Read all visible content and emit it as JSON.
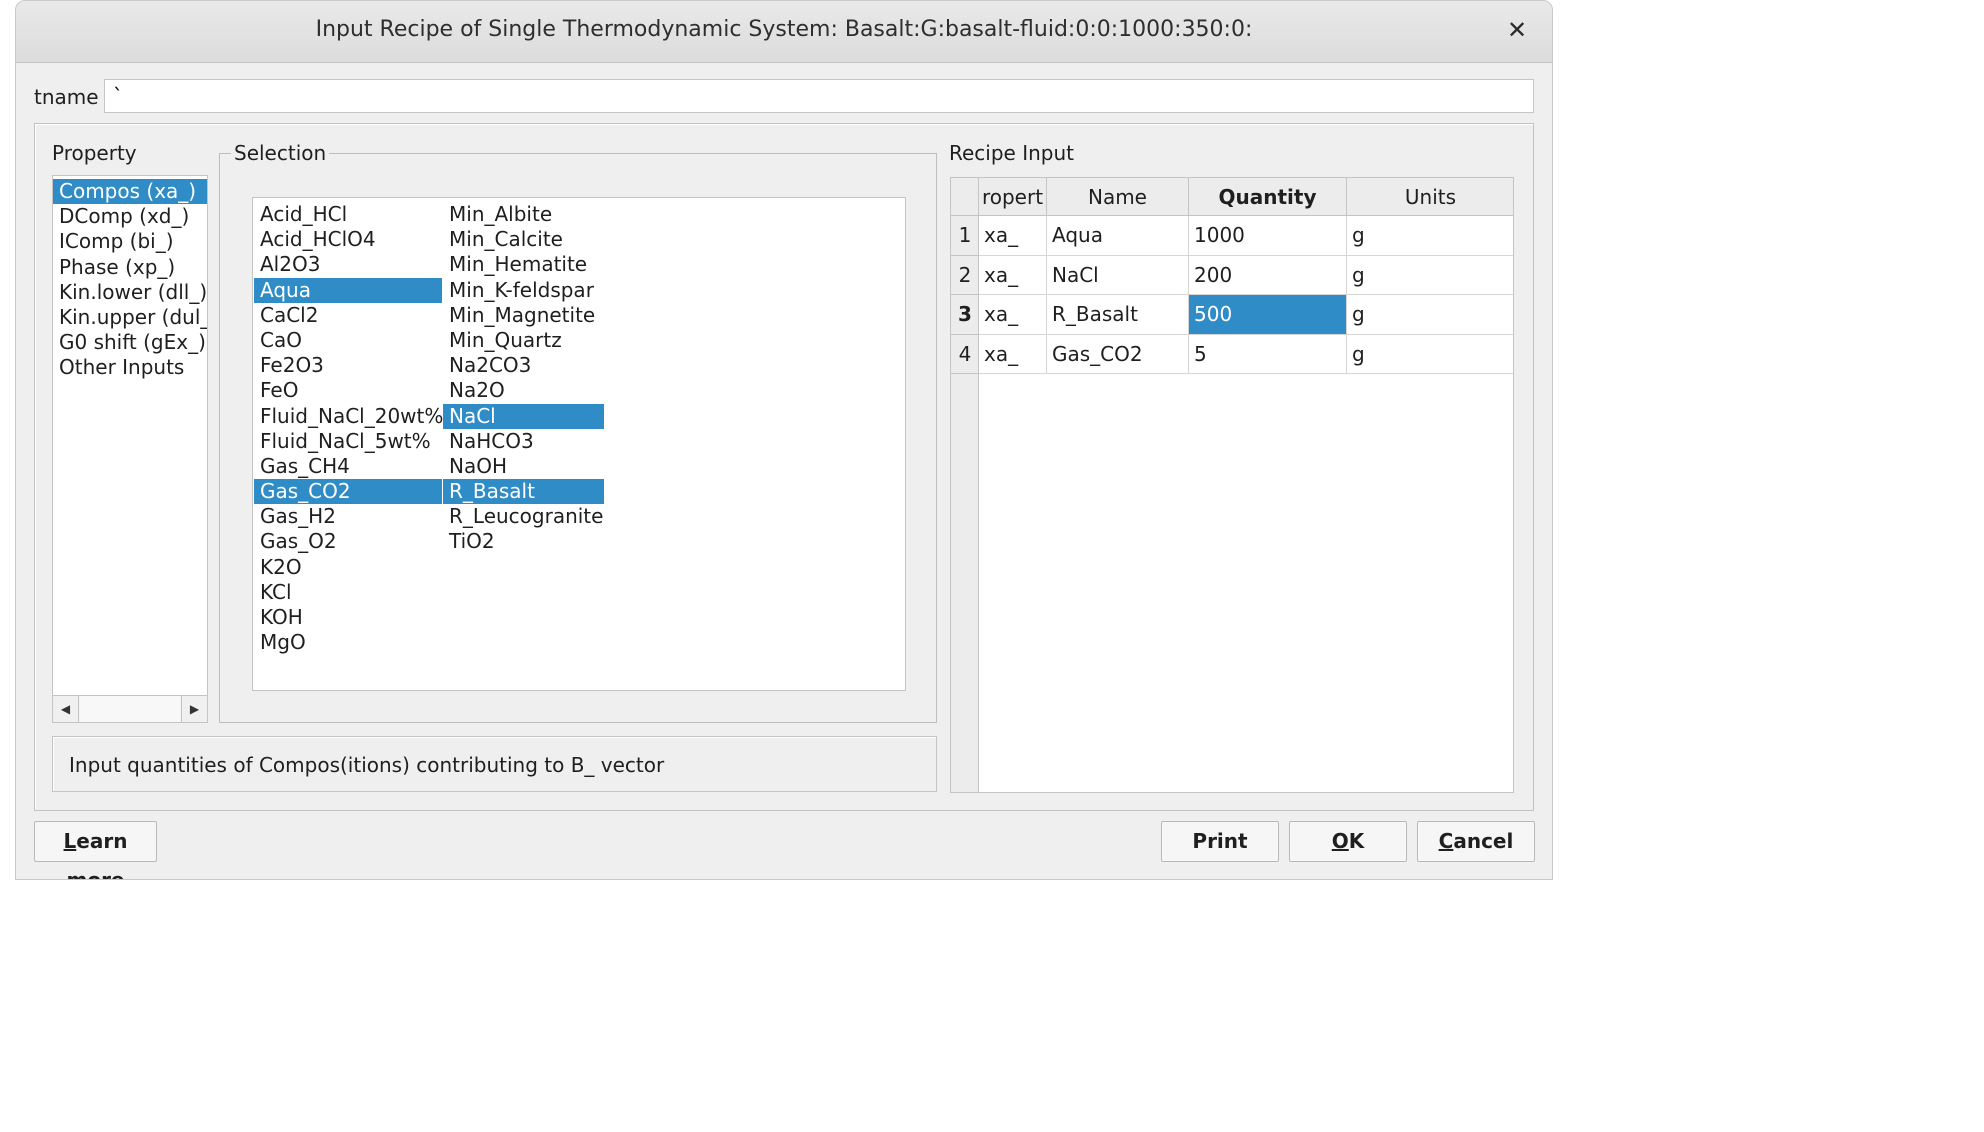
{
  "window": {
    "title": "Input Recipe of Single Thermodynamic System: Basalt:G:basalt-fluid:0:0:1000:350:0:",
    "close_symbol": "✕"
  },
  "tname": {
    "label": "tname",
    "value": "`"
  },
  "property": {
    "label": "Property",
    "items": [
      {
        "label": "Compos (xa_)",
        "selected": true
      },
      {
        "label": "DComp (xd_)",
        "selected": false
      },
      {
        "label": "IComp (bi_)",
        "selected": false
      },
      {
        "label": "Phase (xp_)",
        "selected": false
      },
      {
        "label": "Kin.lower (dll_)",
        "selected": false
      },
      {
        "label": "Kin.upper (dul_)",
        "selected": false
      },
      {
        "label": "G0 shift (gEx_)",
        "selected": false
      },
      {
        "label": "Other Inputs",
        "selected": false
      }
    ],
    "scroll_left_icon": "◀",
    "scroll_right_icon": "▶"
  },
  "selection": {
    "label": "Selection",
    "col1": [
      {
        "label": "Acid_HCl",
        "selected": false
      },
      {
        "label": "Acid_HClO4",
        "selected": false
      },
      {
        "label": "Al2O3",
        "selected": false
      },
      {
        "label": "Aqua",
        "selected": true
      },
      {
        "label": "CaCl2",
        "selected": false
      },
      {
        "label": "CaO",
        "selected": false
      },
      {
        "label": "Fe2O3",
        "selected": false
      },
      {
        "label": "FeO",
        "selected": false
      },
      {
        "label": "Fluid_NaCl_20wt%",
        "selected": false
      },
      {
        "label": "Fluid_NaCl_5wt%",
        "selected": false
      },
      {
        "label": "Gas_CH4",
        "selected": false
      },
      {
        "label": "Gas_CO2",
        "selected": true
      },
      {
        "label": "Gas_H2",
        "selected": false
      },
      {
        "label": "Gas_O2",
        "selected": false
      },
      {
        "label": "K2O",
        "selected": false
      },
      {
        "label": "KCl",
        "selected": false
      },
      {
        "label": "KOH",
        "selected": false
      },
      {
        "label": "MgO",
        "selected": false
      }
    ],
    "col2": [
      {
        "label": "Min_Albite",
        "selected": false
      },
      {
        "label": "Min_Calcite",
        "selected": false
      },
      {
        "label": "Min_Hematite",
        "selected": false
      },
      {
        "label": "Min_K-feldspar",
        "selected": false
      },
      {
        "label": "Min_Magnetite",
        "selected": false
      },
      {
        "label": "Min_Quartz",
        "selected": false
      },
      {
        "label": "Na2CO3",
        "selected": false
      },
      {
        "label": "Na2O",
        "selected": false
      },
      {
        "label": "NaCl",
        "selected": true
      },
      {
        "label": "NaHCO3",
        "selected": false
      },
      {
        "label": "NaOH",
        "selected": false
      },
      {
        "label": "R_Basalt",
        "selected": true
      },
      {
        "label": "R_Leucogranite",
        "selected": false
      },
      {
        "label": "TiO2",
        "selected": false
      }
    ]
  },
  "hint": "Input quantities of Compos(itions) contributing to B_ vector",
  "recipe": {
    "label": "Recipe Input",
    "headers": [
      "ropert",
      "Name",
      "Quantity",
      "Units"
    ],
    "rows": [
      {
        "num": "1",
        "property": "xa_",
        "name": "Aqua",
        "quantity": "1000",
        "units": "g",
        "current": false
      },
      {
        "num": "2",
        "property": "xa_",
        "name": "NaCl",
        "quantity": "200",
        "units": "g",
        "current": false
      },
      {
        "num": "3",
        "property": "xa_",
        "name": "R_Basalt",
        "quantity": "500",
        "units": "g",
        "current": true
      },
      {
        "num": "4",
        "property": "xa_",
        "name": "Gas_CO2",
        "quantity": "5",
        "units": "g",
        "current": false
      }
    ]
  },
  "buttons": {
    "learn_more_first": "L",
    "learn_more_rest": "earn more",
    "print": "Print",
    "ok_first": "O",
    "ok_rest": "K",
    "cancel_first": "C",
    "cancel_rest": "ancel"
  },
  "colors": {
    "selection": "#308cc6",
    "window_bg": "#efefef"
  }
}
